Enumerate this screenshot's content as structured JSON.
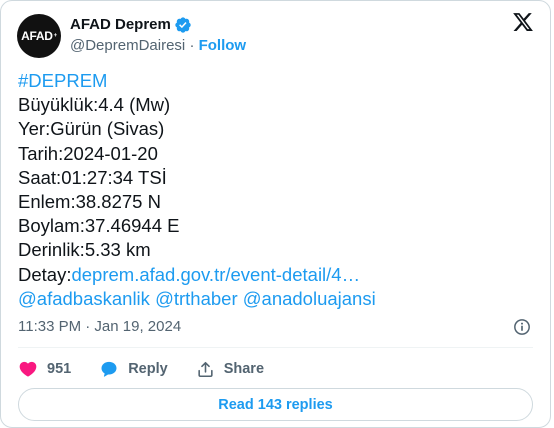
{
  "account": {
    "name": "AFAD Deprem",
    "handle": "@DepremDairesi",
    "separator": "·",
    "follow_label": "Follow",
    "avatar_text": "AFAD",
    "avatar_mark": "+"
  },
  "tweet": {
    "hashtag": "#DEPREM",
    "lines": [
      "Büyüklük:4.4 (Mw)",
      "Yer:Gürün (Sivas)",
      "Tarih:2024-01-20",
      "Saat:01:27:34 TSİ",
      "Enlem:38.8275 N",
      "Boylam:37.46944 E",
      "Derinlik:5.33 km"
    ],
    "detail_label": "Detay:",
    "detail_link": "deprem.afad.gov.tr/event-detail/4…",
    "mentions": [
      "@afadbaskanlik",
      "@trthaber",
      "@anadoluajansi"
    ],
    "timestamp": "11:33 PM · Jan 19, 2024"
  },
  "actions": {
    "like_count": "951",
    "reply_label": "Reply",
    "share_label": "Share"
  },
  "replies_button": "Read 143 replies",
  "colors": {
    "accent": "#1d9bf0",
    "like": "#f91880",
    "text": "#0f1419",
    "muted": "#536471",
    "border": "#cfd9de"
  },
  "icons": [
    "verified-badge-icon",
    "x-logo-icon",
    "info-icon",
    "heart-icon",
    "reply-bubble-icon",
    "share-icon"
  ]
}
